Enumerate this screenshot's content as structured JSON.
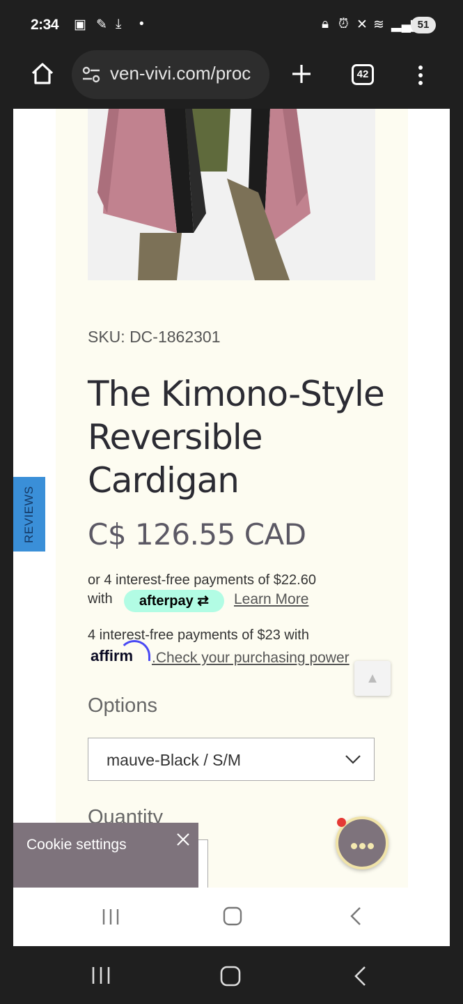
{
  "status_bar": {
    "time": "2:34",
    "battery": "51"
  },
  "browser": {
    "url": "ven-vivi.com/proc",
    "tab_count": "42"
  },
  "product": {
    "sku": "SKU: DC-1862301",
    "title": "The Kimono-Style Reversible Cardigan",
    "price": "C$ 126.55 CAD",
    "afterpay_text": "or 4 interest-free payments of $22.60",
    "afterpay_with": "with",
    "afterpay_badge": "afterpay",
    "afterpay_link": "Learn More",
    "affirm_text": "4 interest-free payments of $23 with",
    "affirm_logo": "affirm",
    "affirm_link": ".Check your purchasing power",
    "options_label": "Options",
    "selected_option": "mauve-Black / S/M",
    "quantity_label": "Quantity"
  },
  "reviews_tab": "REVIEWS",
  "scroll_top": "▲",
  "cookie": {
    "label": "Cookie settings"
  }
}
